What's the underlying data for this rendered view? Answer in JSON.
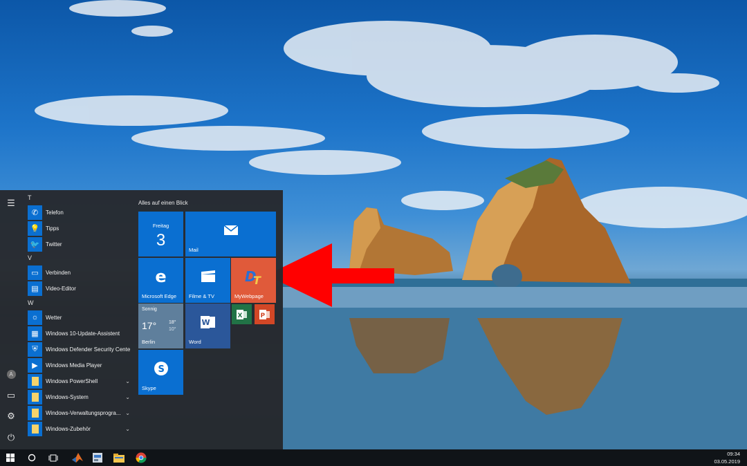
{
  "start_menu": {
    "sections": [
      {
        "letter": "T",
        "apps": [
          {
            "label": "Telefon",
            "icon": "phone-icon"
          },
          {
            "label": "Tipps",
            "icon": "lightbulb-icon"
          },
          {
            "label": "Twitter",
            "icon": "twitter-icon"
          }
        ]
      },
      {
        "letter": "V",
        "apps": [
          {
            "label": "Verbinden",
            "icon": "connect-icon"
          },
          {
            "label": "Video-Editor",
            "icon": "video-editor-icon"
          }
        ]
      },
      {
        "letter": "W",
        "apps": [
          {
            "label": "Wetter",
            "icon": "sun-icon"
          },
          {
            "label": "Windows 10-Update-Assistent",
            "icon": "windows-icon"
          },
          {
            "label": "Windows Defender Security Center",
            "icon": "shield-icon"
          },
          {
            "label": "Windows Media Player",
            "icon": "media-player-icon"
          },
          {
            "label": "Windows PowerShell",
            "icon": "folder-icon"
          },
          {
            "label": "Windows-System",
            "icon": "folder-icon"
          },
          {
            "label": "Windows-Verwaltungsprogra...",
            "icon": "folder-icon"
          },
          {
            "label": "Windows-Zubehör",
            "icon": "folder-icon"
          }
        ]
      }
    ],
    "tiles_header": "Alles auf einen Blick",
    "tiles": {
      "calendar": {
        "day": "Freitag",
        "date": "3"
      },
      "mail": {
        "label": "Mail"
      },
      "edge": {
        "label": "Microsoft Edge"
      },
      "films": {
        "label": "Filme & TV"
      },
      "mywebpage": {
        "label": "MyWebpage"
      },
      "weather": {
        "condition": "Sonnig",
        "temp": "17°",
        "high": "18°",
        "low": "10°",
        "city": "Berlin"
      },
      "word": {
        "label": "Word"
      },
      "skype": {
        "label": "Skype"
      }
    }
  },
  "taskbar": {
    "time": "09:34",
    "date": "03.05.2019"
  },
  "colors": {
    "accent": "#0a6fd1",
    "mywebpage_tile": "#e05a3a",
    "word_tile": "#2b579a",
    "excel_tile": "#217346",
    "powerpoint_tile": "#d24726",
    "arrow": "#ff0000"
  }
}
